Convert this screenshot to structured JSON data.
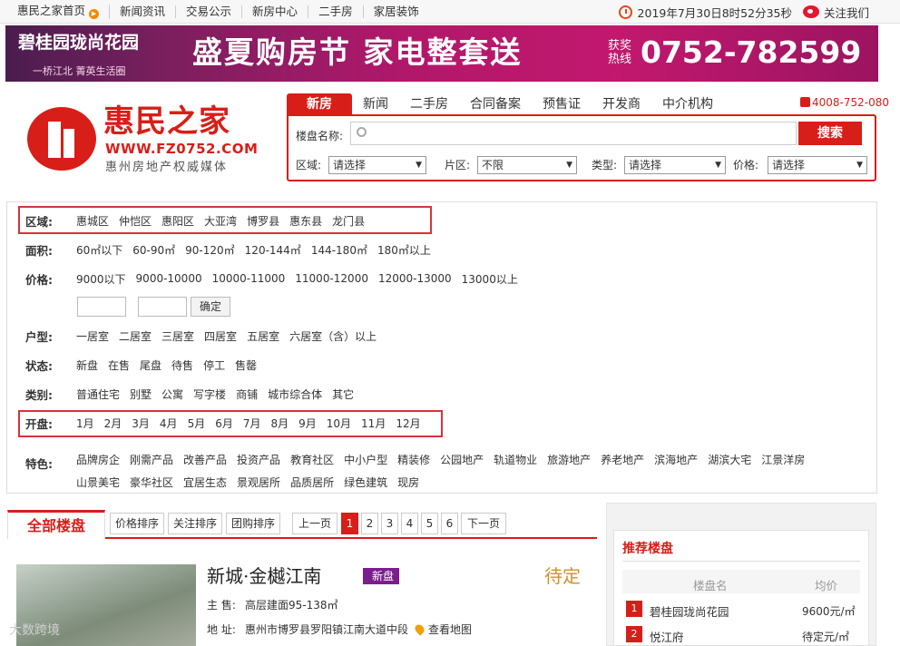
{
  "topnav": {
    "items": [
      "惠民之家首页",
      "新闻资讯",
      "交易公示",
      "新房中心",
      "二手房",
      "家居装饰"
    ],
    "datetime": "2019年7月30日8时52分35秒",
    "follow": "关注我们"
  },
  "banner": {
    "logo_text": "碧桂园珑尚花园",
    "sub_text": "一桥江北 菁英生活圈",
    "headline": "盛夏购房节 家电整套送",
    "hotline_label": "获奖热线",
    "phone": "0752-782599"
  },
  "logo": {
    "name": "惠民之家",
    "url": "WWW.FZ0752.COM",
    "slogan": "惠州房地产权威媒体"
  },
  "search": {
    "tabs": [
      "新房",
      "新闻",
      "二手房",
      "合同备案",
      "预售证",
      "开发商",
      "中介机构"
    ],
    "hotline": "4008-752-080",
    "name_label": "楼盘名称:",
    "button": "搜索",
    "filters": [
      {
        "label": "区域:",
        "value": "请选择"
      },
      {
        "label": "片区:",
        "value": "不限"
      },
      {
        "label": "类型:",
        "value": "请选择"
      },
      {
        "label": "价格:",
        "value": "请选择"
      }
    ]
  },
  "filters": {
    "area": {
      "label": "区域:",
      "options": [
        "惠城区",
        "仲恺区",
        "惠阳区",
        "大亚湾",
        "博罗县",
        "惠东县",
        "龙门县"
      ]
    },
    "size": {
      "label": "面积:",
      "options": [
        "60㎡以下",
        "60-90㎡",
        "90-120㎡",
        "120-144㎡",
        "144-180㎡",
        "180㎡以上"
      ]
    },
    "price": {
      "label": "价格:",
      "options": [
        "9000以下",
        "9000-10000",
        "10000-11000",
        "11000-12000",
        "12000-13000",
        "13000以上"
      ],
      "confirm": "确定"
    },
    "layout": {
      "label": "户型:",
      "options": [
        "一居室",
        "二居室",
        "三居室",
        "四居室",
        "五居室",
        "六居室（含）以上"
      ]
    },
    "status": {
      "label": "状态:",
      "options": [
        "新盘",
        "在售",
        "尾盘",
        "待售",
        "停工",
        "售罄"
      ]
    },
    "category": {
      "label": "类别:",
      "options": [
        "普通住宅",
        "别墅",
        "公寓",
        "写字楼",
        "商铺",
        "城市综合体",
        "其它"
      ]
    },
    "opening": {
      "label": "开盘:",
      "options": [
        "1月",
        "2月",
        "3月",
        "4月",
        "5月",
        "6月",
        "7月",
        "8月",
        "9月",
        "10月",
        "11月",
        "12月"
      ]
    },
    "feature": {
      "label": "特色:",
      "options": [
        "品牌房企",
        "刚需产品",
        "改善产品",
        "投资产品",
        "教育社区",
        "中小户型",
        "精装修",
        "公园地产",
        "轨道物业",
        "旅游地产",
        "养老地产",
        "滨海地产",
        "湖滨大宅",
        "江景洋房",
        "山景美宅",
        "豪华社区",
        "宜居生态",
        "景观居所",
        "品质居所",
        "绿色建筑",
        "现房"
      ]
    }
  },
  "listing": {
    "tab": "全部楼盘",
    "sorts": [
      "价格排序",
      "关注排序",
      "团购排序"
    ],
    "prev": "上一页",
    "pages": [
      "1",
      "2",
      "3",
      "4",
      "5",
      "6"
    ],
    "next": "下一页",
    "item": {
      "title": "新城·金樾江南",
      "badge": "新盘",
      "status": "待定",
      "main_label": "主  售:",
      "main": "高层建面95-138㎡",
      "addr_label": "地  址:",
      "addr": "惠州市博罗县罗阳镇江南大道中段",
      "map": "查看地图"
    }
  },
  "recommend": {
    "title": "推荐楼盘",
    "col_name": "楼盘名",
    "col_price": "均价",
    "items": [
      {
        "rank": "1",
        "name": "碧桂园珑尚花园",
        "price": "9600元/㎡"
      },
      {
        "rank": "2",
        "name": "悦江府",
        "price": "待定元/㎡"
      }
    ]
  },
  "watermark": "大数跨境"
}
